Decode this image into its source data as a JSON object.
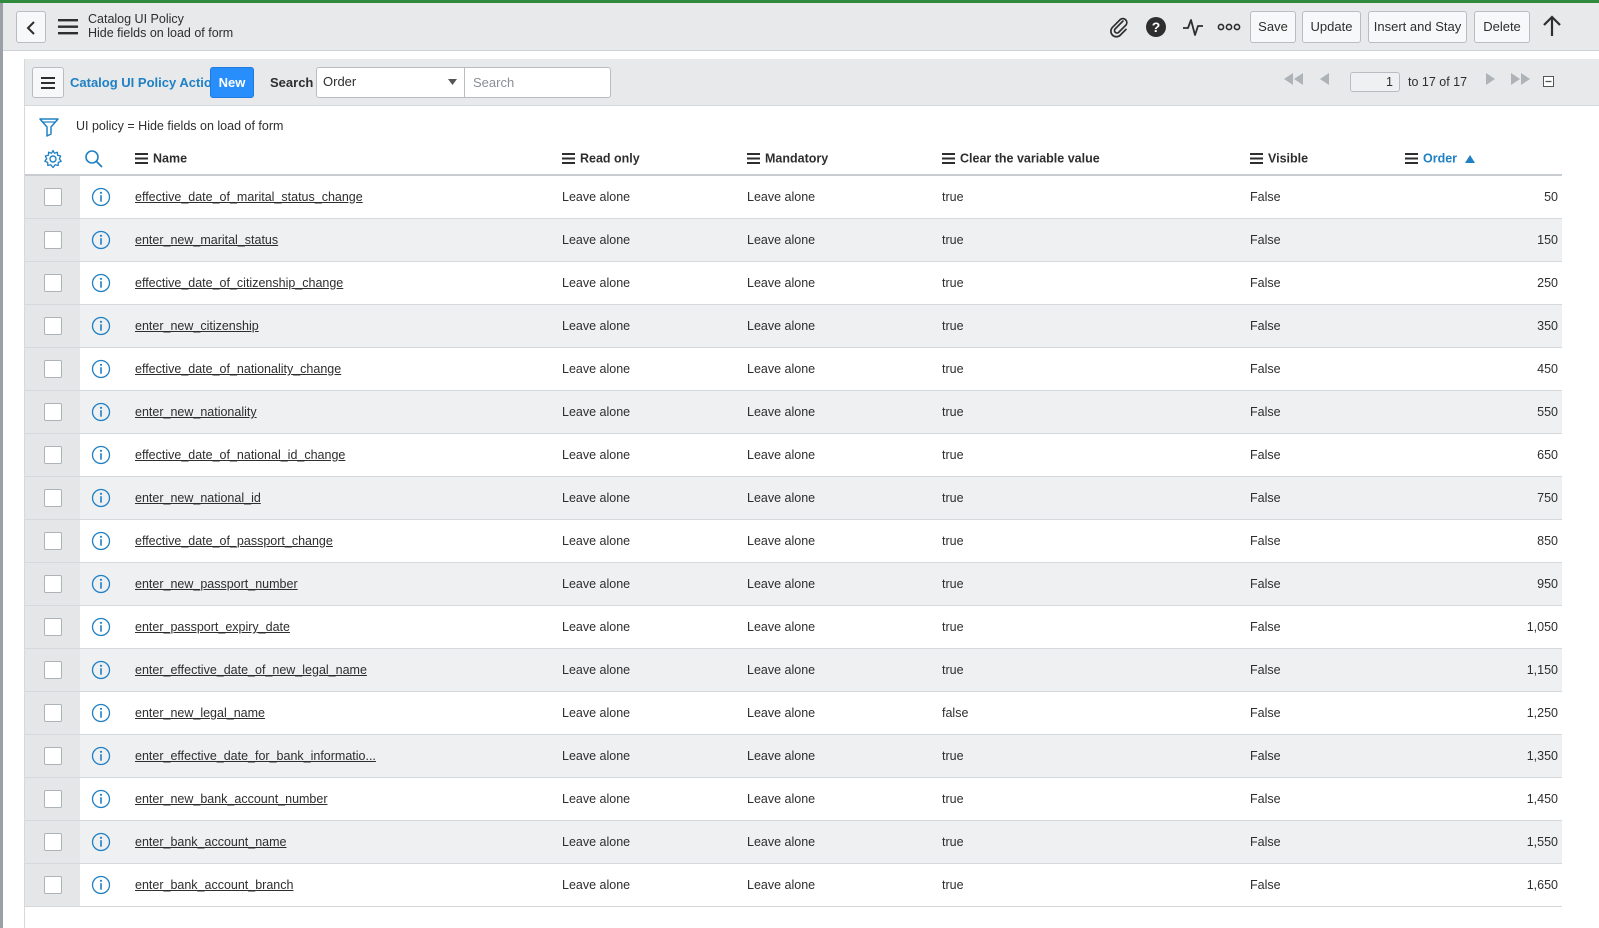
{
  "header": {
    "title": "Catalog UI Policy",
    "subtitle": "Hide fields on load of form",
    "buttons": {
      "save": "Save",
      "update": "Update",
      "insert_and_stay": "Insert and Stay",
      "delete": "Delete"
    },
    "icons": [
      "back-icon",
      "menu-icon",
      "paperclip-icon",
      "help-icon",
      "activity-icon",
      "more-icon",
      "scroll-top-icon"
    ]
  },
  "related_list": {
    "title": "Catalog UI Policy Actions",
    "new_label": "New",
    "search_label": "Search",
    "search_field": "Order",
    "search_placeholder": "Search",
    "page_value": "1",
    "page_of": "to 17 of 17",
    "filter_text": "UI policy = Hide fields on load of form",
    "columns": {
      "name": "Name",
      "read_only": "Read only",
      "mandatory": "Mandatory",
      "clear_value": "Clear the variable value",
      "visible": "Visible",
      "order": "Order"
    },
    "sorted_column": "order",
    "sort_direction": "ascending",
    "rows": [
      {
        "name": "effective_date_of_marital_status_change",
        "read_only": "Leave alone",
        "mandatory": "Leave alone",
        "clear": "true",
        "visible": "False",
        "order": "50"
      },
      {
        "name": "enter_new_marital_status",
        "read_only": "Leave alone",
        "mandatory": "Leave alone",
        "clear": "true",
        "visible": "False",
        "order": "150"
      },
      {
        "name": "effective_date_of_citizenship_change",
        "read_only": "Leave alone",
        "mandatory": "Leave alone",
        "clear": "true",
        "visible": "False",
        "order": "250"
      },
      {
        "name": "enter_new_citizenship",
        "read_only": "Leave alone",
        "mandatory": "Leave alone",
        "clear": "true",
        "visible": "False",
        "order": "350"
      },
      {
        "name": "effective_date_of_nationality_change",
        "read_only": "Leave alone",
        "mandatory": "Leave alone",
        "clear": "true",
        "visible": "False",
        "order": "450"
      },
      {
        "name": "enter_new_nationality",
        "read_only": "Leave alone",
        "mandatory": "Leave alone",
        "clear": "true",
        "visible": "False",
        "order": "550"
      },
      {
        "name": "effective_date_of_national_id_change",
        "read_only": "Leave alone",
        "mandatory": "Leave alone",
        "clear": "true",
        "visible": "False",
        "order": "650"
      },
      {
        "name": "enter_new_national_id",
        "read_only": "Leave alone",
        "mandatory": "Leave alone",
        "clear": "true",
        "visible": "False",
        "order": "750"
      },
      {
        "name": "effective_date_of_passport_change",
        "read_only": "Leave alone",
        "mandatory": "Leave alone",
        "clear": "true",
        "visible": "False",
        "order": "850"
      },
      {
        "name": "enter_new_passport_number",
        "read_only": "Leave alone",
        "mandatory": "Leave alone",
        "clear": "true",
        "visible": "False",
        "order": "950"
      },
      {
        "name": "enter_passport_expiry_date",
        "read_only": "Leave alone",
        "mandatory": "Leave alone",
        "clear": "true",
        "visible": "False",
        "order": "1,050"
      },
      {
        "name": "enter_effective_date_of_new_legal_name",
        "read_only": "Leave alone",
        "mandatory": "Leave alone",
        "clear": "true",
        "visible": "False",
        "order": "1,150"
      },
      {
        "name": "enter_new_legal_name",
        "read_only": "Leave alone",
        "mandatory": "Leave alone",
        "clear": "false",
        "visible": "False",
        "order": "1,250"
      },
      {
        "name": "enter_effective_date_for_bank_informatio...",
        "read_only": "Leave alone",
        "mandatory": "Leave alone",
        "clear": "true",
        "visible": "False",
        "order": "1,350"
      },
      {
        "name": "enter_new_bank_account_number",
        "read_only": "Leave alone",
        "mandatory": "Leave alone",
        "clear": "true",
        "visible": "False",
        "order": "1,450"
      },
      {
        "name": "enter_bank_account_name",
        "read_only": "Leave alone",
        "mandatory": "Leave alone",
        "clear": "true",
        "visible": "False",
        "order": "1,550"
      },
      {
        "name": "enter_bank_account_branch",
        "read_only": "Leave alone",
        "mandatory": "Leave alone",
        "clear": "true",
        "visible": "False",
        "order": "1,650"
      }
    ]
  },
  "colors": {
    "accent": "#278efc",
    "link": "#1f80c4",
    "top_bar": "#2f8a3e"
  }
}
